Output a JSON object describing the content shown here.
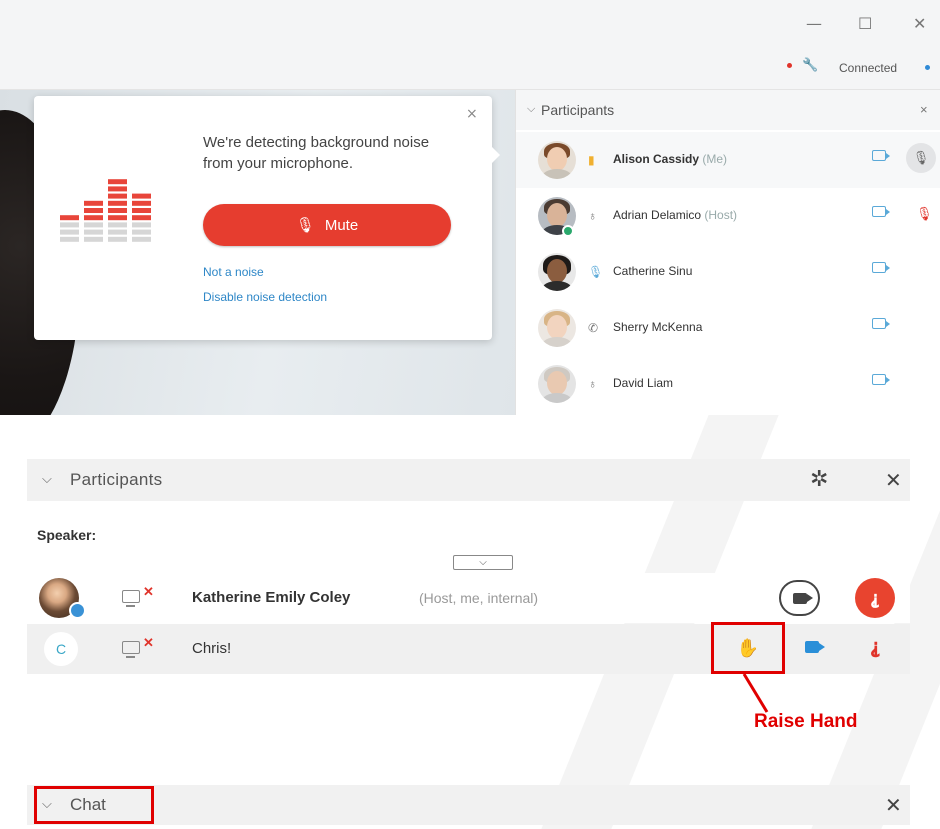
{
  "top_window": {
    "minimize_glyph": "—",
    "maximize_glyph": "☐",
    "close_glyph": "✕",
    "connection_status": "Connected",
    "noise_popup": {
      "message": "We're detecting background noise from your microphone.",
      "mute_label": "Mute",
      "not_a_noise_link": "Not a noise",
      "disable_link": "Disable noise detection",
      "close_glyph": "×"
    },
    "participants_panel": {
      "title": "Participants",
      "close_glyph": "×",
      "participants": [
        {
          "name": "Alison Cassidy",
          "role": "(Me)"
        },
        {
          "name": "Adrian Delamico",
          "role": "(Host)"
        },
        {
          "name": "Catherine Sinu",
          "role": ""
        },
        {
          "name": "Sherry McKenna",
          "role": ""
        },
        {
          "name": "David Liam",
          "role": ""
        }
      ]
    }
  },
  "bottom_window": {
    "participants_panel": {
      "title": "Participants",
      "speaker_label": "Speaker:",
      "participants": [
        {
          "name": "Katherine Emily Coley",
          "role": "(Host, me, internal)"
        },
        {
          "name": "Chris!",
          "avatar_initial": "C"
        }
      ]
    },
    "callout": {
      "label": "Raise Hand"
    },
    "chat_panel": {
      "title": "Chat"
    }
  },
  "colors": {
    "mute_red": "#e63d2f",
    "link_blue": "#2e87c7",
    "callout_red": "#e00000",
    "camera_blue": "#2a8fd8"
  },
  "icons": [
    "minimize-icon",
    "maximize-icon",
    "close-icon",
    "wrench-icon",
    "equalizer-icon",
    "microphone-icon",
    "camera-icon",
    "muted-mic-icon",
    "gear-icon",
    "screen-share-off-icon",
    "raise-hand-icon",
    "chevron-down-icon"
  ]
}
